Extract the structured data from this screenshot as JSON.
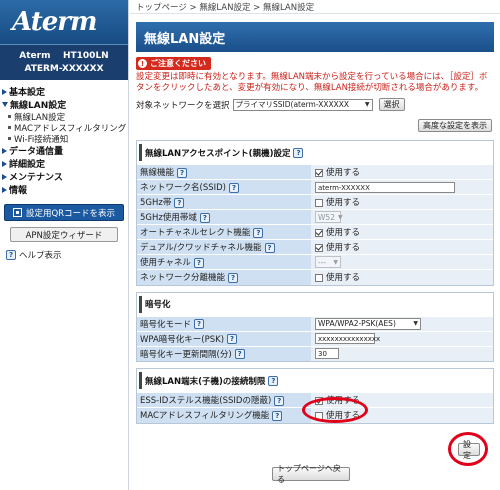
{
  "sidebar": {
    "logo": "Aterm",
    "model_line1": "Aterm    HT100LN",
    "model_line2": "ATERM-XXXXXX",
    "menu": [
      {
        "label": "基本設定",
        "open": false
      },
      {
        "label": "無線LAN設定",
        "open": true
      },
      {
        "label": "データ通信量",
        "open": false
      },
      {
        "label": "詳細設定",
        "open": false
      },
      {
        "label": "メンテナンス",
        "open": false
      },
      {
        "label": "情報",
        "open": false
      }
    ],
    "submenu": [
      "無線LAN設定",
      "MACアドレスフィルタリング",
      "Wi-Fi接続通知"
    ],
    "qr_button": "設定用QRコードを表示",
    "apn_button": "APN設定ウィザード",
    "help": "ヘルプ表示"
  },
  "main": {
    "breadcrumb": "トップページ > 無線LAN設定 > 無線LAN設定",
    "title": "無線LAN設定",
    "notice_badge": "ご注意ください",
    "notice_text": "設定変更は即時に有効となります。無線LAN端末から設定を行っている場合には、［設定］ボタンをクリックしたあと、変更が有効になり、無線LAN接続が切断される場合があります。",
    "target_label": "対象ネットワークを選択",
    "target_value": "プライマリSSID(aterm-XXXXXX",
    "select_button": "選択",
    "advanced_button": "高度な設定を表示",
    "home_button": "トップページへ戻る",
    "set_button": "設定"
  },
  "sections": {
    "ap": {
      "title": "無線LANアクセスポイント(親機)設定",
      "rows": {
        "wireless": {
          "label": "無線機能",
          "text": "使用する",
          "checked": true
        },
        "ssid": {
          "label": "ネットワーク名(SSID)",
          "value": "aterm-XXXXXX"
        },
        "band5": {
          "label": "5GHz帯",
          "text": "使用する",
          "checked": false
        },
        "band5_width": {
          "label": "5GHz使用帯域",
          "value": "W52"
        },
        "auto_channel": {
          "label": "オートチャネルセレクト機能",
          "text": "使用する",
          "checked": true
        },
        "dual": {
          "label": "デュアル/クワッドチャネル機能",
          "text": "使用する",
          "checked": true
        },
        "channel": {
          "label": "使用チャネル",
          "value": "---"
        },
        "separation": {
          "label": "ネットワーク分離機能",
          "text": "使用する",
          "checked": false
        }
      }
    },
    "enc": {
      "title": "暗号化",
      "rows": {
        "mode": {
          "label": "暗号化モード",
          "value": "WPA/WPA2-PSK(AES)"
        },
        "key": {
          "label": "WPA暗号化キー(PSK)",
          "value": "xxxxxxxxxxxxxxx"
        },
        "interval": {
          "label": "暗号化キー更新間隔(分)",
          "value": "30"
        }
      }
    },
    "limit": {
      "title": "無線LAN端末(子機)の接続制限",
      "rows": {
        "stealth": {
          "label": "ESS-IDステルス機能(SSIDの隠蔽)",
          "text": "使用する",
          "checked": true
        },
        "macfilter": {
          "label": "MACアドレスフィルタリング機能",
          "text": "使用する",
          "checked": false
        }
      }
    }
  },
  "colors": {
    "accent": "#1b5aa0",
    "highlight": "#e0001a",
    "notice": "#c8221a"
  }
}
